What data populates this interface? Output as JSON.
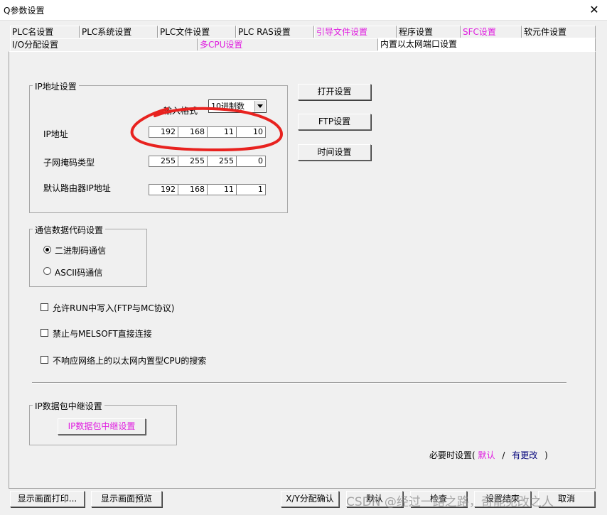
{
  "window": {
    "title": "Q参数设置",
    "close_glyph": "✕"
  },
  "tabs_row1": [
    "PLC名设置",
    "PLC系统设置",
    "PLC文件设置",
    "PLC RAS设置",
    "引导文件设置",
    "程序设置",
    "SFC设置",
    "软元件设置"
  ],
  "tabs_row2": [
    "I/O分配设置",
    "多CPU设置",
    "内置以太网端口设置"
  ],
  "ip_group": {
    "title": "IP地址设置",
    "input_format_label": "输入格式",
    "input_format_value": "10进制数",
    "ip_label": "IP地址",
    "ip": [
      "192",
      "168",
      "11",
      "10"
    ],
    "subnet_label": "子网掩码类型",
    "subnet": [
      "255",
      "255",
      "255",
      "0"
    ],
    "gateway_label": "默认路由器IP地址",
    "gateway": [
      "192",
      "168",
      "11",
      "1"
    ]
  },
  "side_buttons": {
    "open": "打开设置",
    "ftp": "FTP设置",
    "time": "时间设置"
  },
  "comm_group": {
    "title": "通信数据代码设置",
    "binary": "二进制码通信",
    "ascii": "ASCII码通信"
  },
  "checkboxes": {
    "allow_run_write": "允许RUN中写入(FTP与MC协议)",
    "prohibit_melsoft": "禁止与MELSOFT直接连接",
    "no_respond_search": "不响应网络上的以太网内置型CPU的搜索"
  },
  "relay_group": {
    "title": "IP数据包中继设置",
    "button": "IP数据包中继设置"
  },
  "settings_hint": {
    "prefix": "必要时设置(",
    "default": "默认",
    "sep": "/",
    "changed": "有更改",
    "suffix": ")"
  },
  "bottom_buttons": {
    "print": "显示画面打印...",
    "preview": "显示画面预览",
    "xy": "X/Y分配确认",
    "default": "默认",
    "check": "检查",
    "finish": "设置结束",
    "cancel": "取消"
  },
  "watermark": "CSDN @经过一路之路，奇能见改之人",
  "annotation": {
    "color": "#e8221f"
  }
}
